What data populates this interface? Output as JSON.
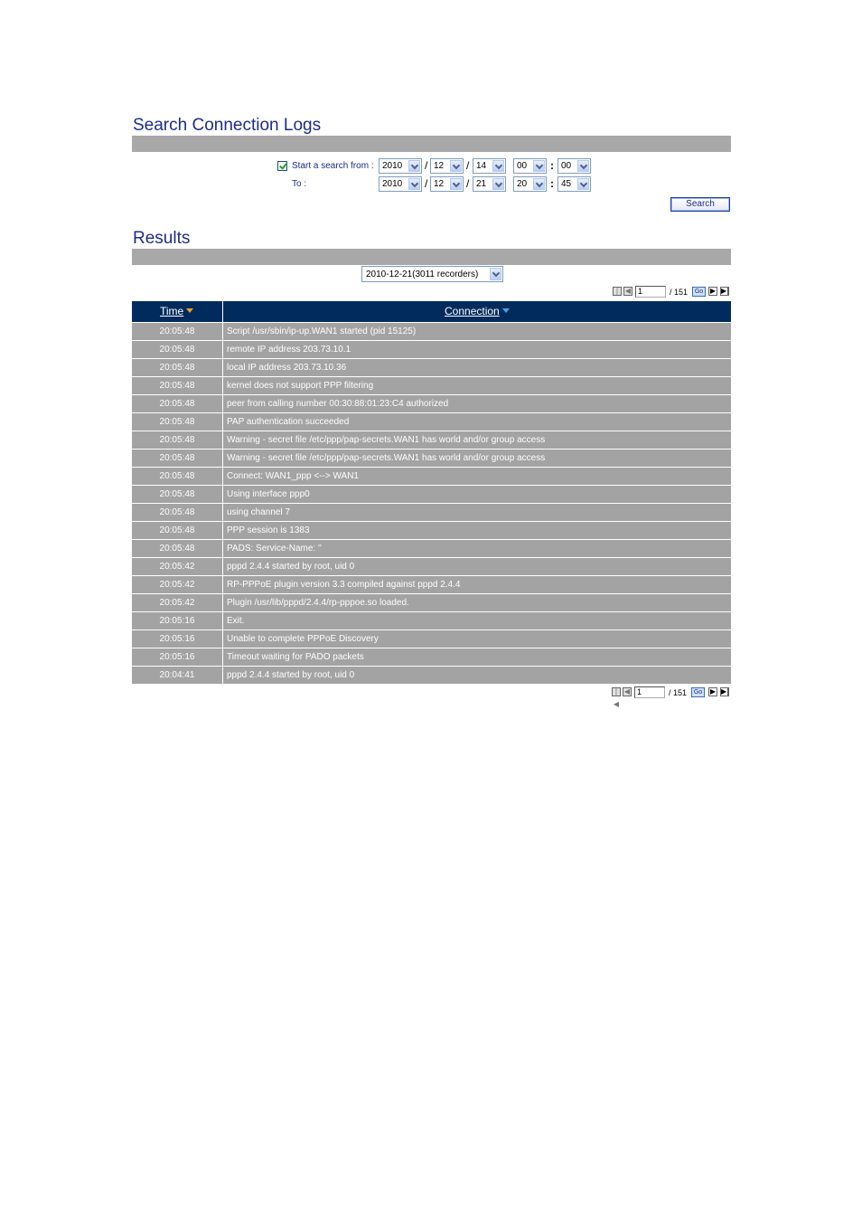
{
  "search": {
    "title": "Search Connection Logs",
    "start_label": "Start a search from :",
    "to_label": "To :",
    "from": {
      "year": "2010",
      "month": "12",
      "day": "14",
      "hour": "00",
      "minute": "00"
    },
    "to": {
      "year": "2010",
      "month": "12",
      "day": "21",
      "hour": "20",
      "minute": "45"
    },
    "date_sep": "/",
    "time_sep": ":",
    "button_label": "Search"
  },
  "results": {
    "title": "Results",
    "date_select": "2010-12-21(3011 recorders)",
    "pagination": {
      "page": "1",
      "total": "/ 151",
      "go_label": "Go"
    },
    "headers": {
      "time": "Time",
      "connection": "Connection"
    },
    "rows": [
      {
        "time": "20:05:48",
        "connection": "Script /usr/sbin/ip-up.WAN1 started (pid 15125)"
      },
      {
        "time": "20:05:48",
        "connection": "remote IP address 203.73.10.1"
      },
      {
        "time": "20:05:48",
        "connection": "local IP address 203.73.10.36"
      },
      {
        "time": "20:05:48",
        "connection": "kernel does not support PPP filtering"
      },
      {
        "time": "20:05:48",
        "connection": "peer from calling number 00:30:88:01:23:C4 authorized"
      },
      {
        "time": "20:05:48",
        "connection": "PAP authentication succeeded"
      },
      {
        "time": "20:05:48",
        "connection": "Warning - secret file /etc/ppp/pap-secrets.WAN1 has world and/or group access"
      },
      {
        "time": "20:05:48",
        "connection": "Warning - secret file /etc/ppp/pap-secrets.WAN1 has world and/or group access"
      },
      {
        "time": "20:05:48",
        "connection": "Connect: WAN1_ppp <--> WAN1"
      },
      {
        "time": "20:05:48",
        "connection": "Using interface ppp0"
      },
      {
        "time": "20:05:48",
        "connection": "using channel 7"
      },
      {
        "time": "20:05:48",
        "connection": "PPP session is 1383"
      },
      {
        "time": "20:05:48",
        "connection": "PADS: Service-Name: ''"
      },
      {
        "time": "20:05:42",
        "connection": "pppd 2.4.4 started by root, uid 0"
      },
      {
        "time": "20:05:42",
        "connection": "RP-PPPoE plugin version 3.3 compiled against pppd 2.4.4"
      },
      {
        "time": "20:05:42",
        "connection": "Plugin /usr/lib/pppd/2.4.4/rp-pppoe.so loaded."
      },
      {
        "time": "20:05:16",
        "connection": "Exit."
      },
      {
        "time": "20:05:16",
        "connection": "Unable to complete PPPoE Discovery"
      },
      {
        "time": "20:05:16",
        "connection": "Timeout waiting for PADO packets"
      },
      {
        "time": "20:04:41",
        "connection": "pppd 2.4.4 started by root, uid 0"
      }
    ]
  }
}
